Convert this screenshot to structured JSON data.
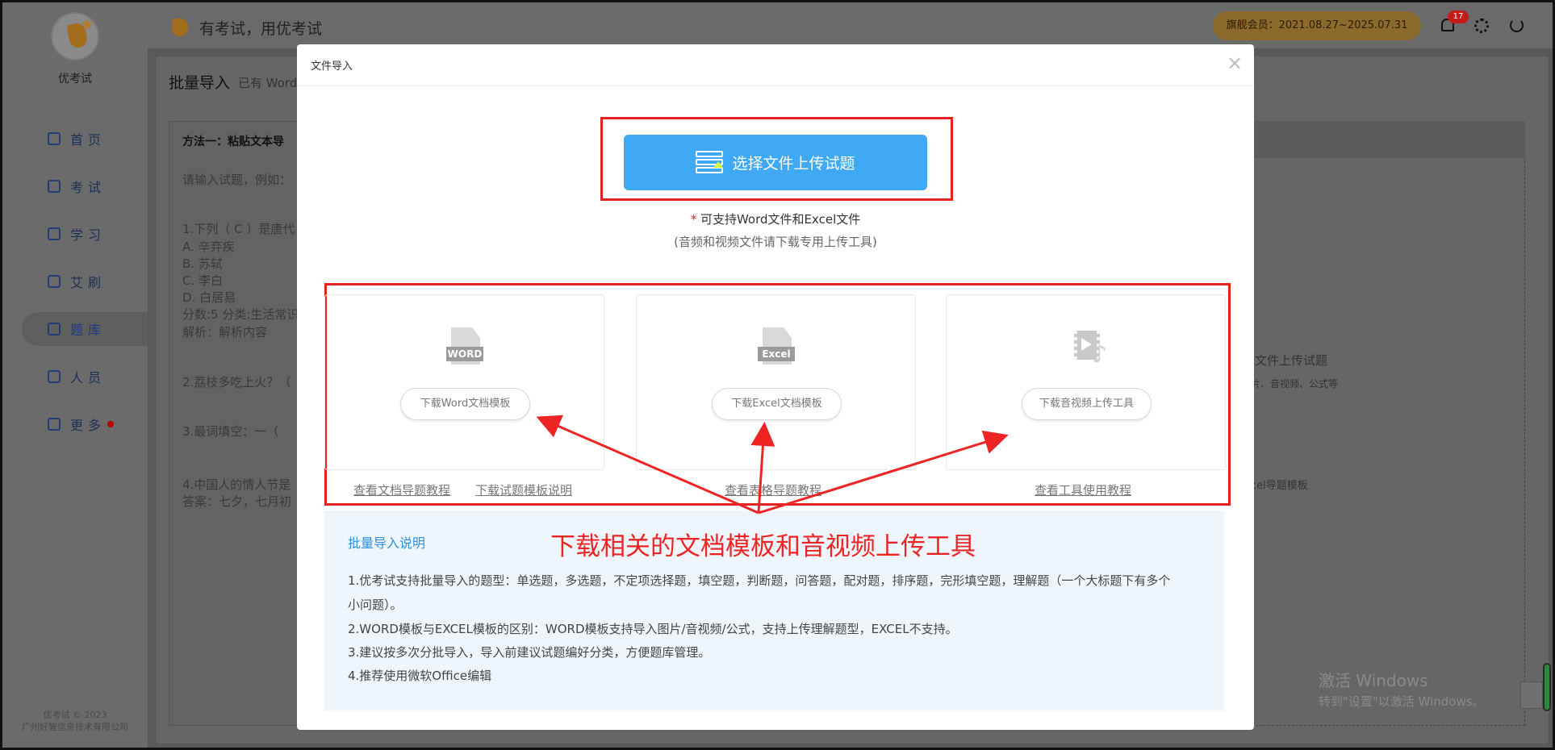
{
  "sidebar": {
    "brand": "优考试",
    "items": [
      {
        "label": "首页",
        "icon": "home-icon"
      },
      {
        "label": "考试",
        "icon": "exam-icon"
      },
      {
        "label": "学习",
        "icon": "book-icon"
      },
      {
        "label": "艾刷",
        "icon": "brush-icon"
      },
      {
        "label": "题库",
        "icon": "chart-icon",
        "active": true
      },
      {
        "label": "人员",
        "icon": "user-icon"
      },
      {
        "label": "更多",
        "icon": "apps-icon",
        "dot": true
      }
    ],
    "copyright_1": "优考试 © 2023",
    "copyright_2": "广州好智信息技术有限公司"
  },
  "topbar": {
    "slogan": "有考试，用优考试",
    "vip": "旗舰会员：2021.08.27~2025.07.31",
    "notifications": "17"
  },
  "background": {
    "title": "批量导入",
    "title_sub": "已有 Word",
    "method_title": "方法一：粘贴文本导",
    "hint": "请输入试题，例如：",
    "q1": "1.下列（ C ）是唐代",
    "opt_a": "A. 辛弃疾",
    "opt_b": "B. 苏轼",
    "opt_c": "C. 李白",
    "opt_d": "D. 白居易",
    "score": "分数:5 分类:生活常识",
    "analysis": "解析：解析内容",
    "q2": "2.荔枝多吃上火？（",
    "q3": "3.最词填空：一（",
    "q4": "4.中国人的情人节是",
    "q4_answer": "答案：七夕，七月初",
    "right_upload": "择文件上传试题",
    "right_support": "片、音视频、公式等",
    "right_excel": "cel导题模板"
  },
  "modal": {
    "title": "文件导入",
    "close": "×",
    "upload_label": "选择文件上传试题",
    "support_star": "*",
    "support_text": "可支持Word文件和Excel文件",
    "support_sub": "(音频和视频文件请下载专用上传工具)",
    "cards": [
      {
        "label": "WORD",
        "button": "下载Word文档模板"
      },
      {
        "label": "Excel",
        "button": "下载Excel文档模板"
      },
      {
        "label": "",
        "button": "下载音视频上传工具"
      }
    ],
    "links": {
      "word_tutorial": "查看文档导题教程",
      "template_info": "下载试题模板说明",
      "excel_tutorial": "查看表格导题教程",
      "tool_tutorial": "查看工具使用教程"
    },
    "info": {
      "title": "批量导入说明",
      "line1": "1.优考试支持批量导入的题型：单选题，多选题，不定项选择题，填空题，判断题，问答题，配对题，排序题，完形填空题，理解题（一个大标题下有多个",
      "line1b": "小问题）。",
      "line2": "2.WORD模板与EXCEL模板的区别：WORD模板支持导入图片/音视频/公式，支持上传理解题型，EXCEL不支持。",
      "line3": "3.建议按多次分批导入，导入前建议试题编好分类，方便题库管理。",
      "line4": "4.推荐使用微软Office编辑"
    }
  },
  "annotation": "下载相关的文档模板和音视频上传工具",
  "watermark": {
    "line1": "激活 Windows",
    "line2": "转到\"设置\"以激活 Windows。"
  }
}
